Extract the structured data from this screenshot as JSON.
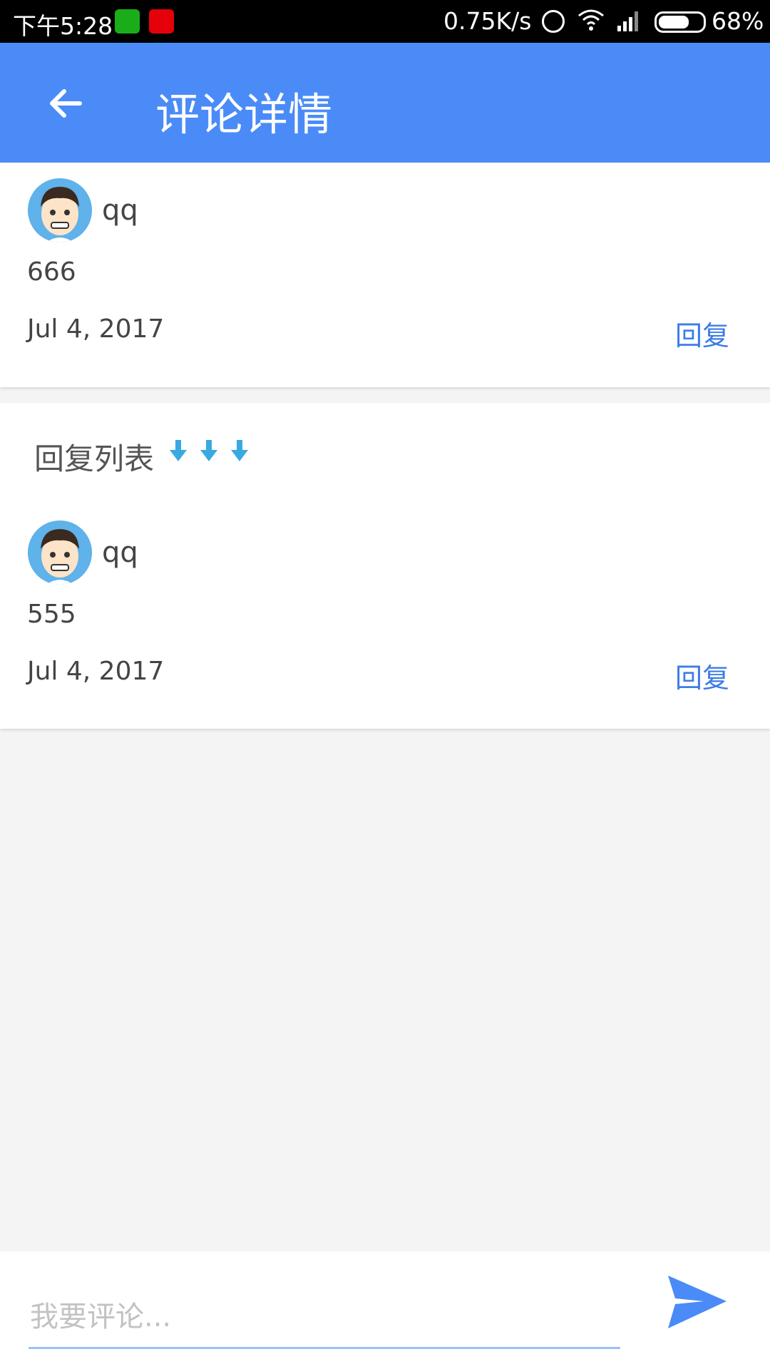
{
  "status_bar": {
    "time": "下午5:28",
    "speed": "0.75K/s",
    "battery": "68%"
  },
  "app_bar": {
    "title": "评论详情"
  },
  "comment": {
    "username": "qq",
    "content": "666",
    "date": "Jul 4, 2017",
    "reply_label": "回复"
  },
  "replies": {
    "title": "回复列表",
    "items": [
      {
        "username": "qq",
        "content": "555",
        "date": "Jul 4, 2017",
        "reply_label": "回复"
      }
    ]
  },
  "input": {
    "placeholder": "我要评论..."
  },
  "colors": {
    "primary": "#4a8bf7",
    "reply_text": "#3d7ce8",
    "arrow": "#3aa9e0"
  }
}
